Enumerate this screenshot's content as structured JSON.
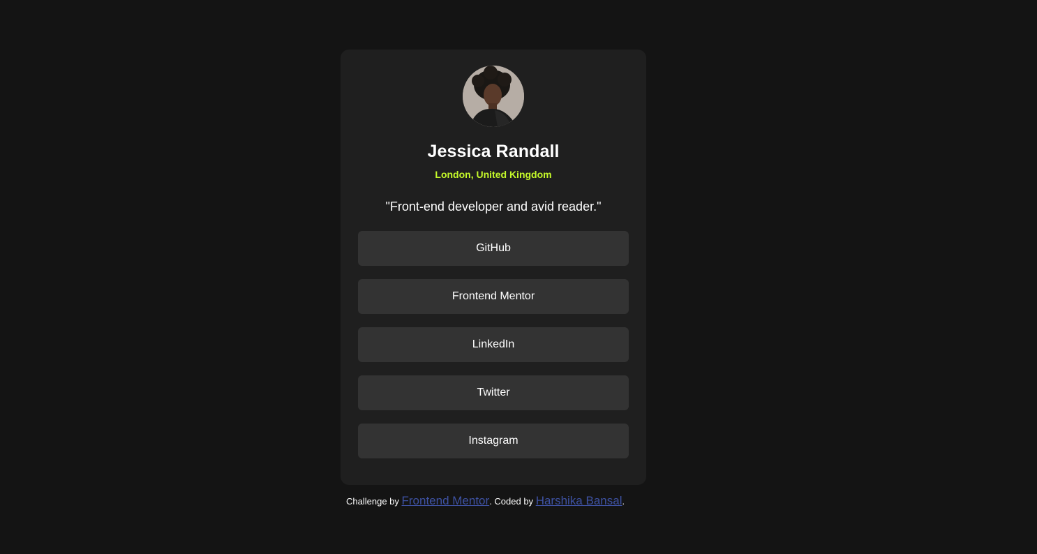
{
  "profile": {
    "name": "Jessica Randall",
    "location": "London, United Kingdom",
    "bio": "\"Front-end developer and avid reader.\""
  },
  "links": [
    {
      "label": "GitHub"
    },
    {
      "label": "Frontend Mentor"
    },
    {
      "label": "LinkedIn"
    },
    {
      "label": "Twitter"
    },
    {
      "label": "Instagram"
    }
  ],
  "attribution": {
    "prefix": "Challenge by ",
    "challenge_link": "Frontend Mentor",
    "middle": ". Coded by ",
    "author_link": "Harshika Bansal",
    "suffix": "."
  },
  "colors": {
    "page_background": "#141414",
    "card_background": "#1f1f1f",
    "button_background": "#333333",
    "accent_green": "#c4f82a",
    "link_blue": "#3e52a3"
  }
}
